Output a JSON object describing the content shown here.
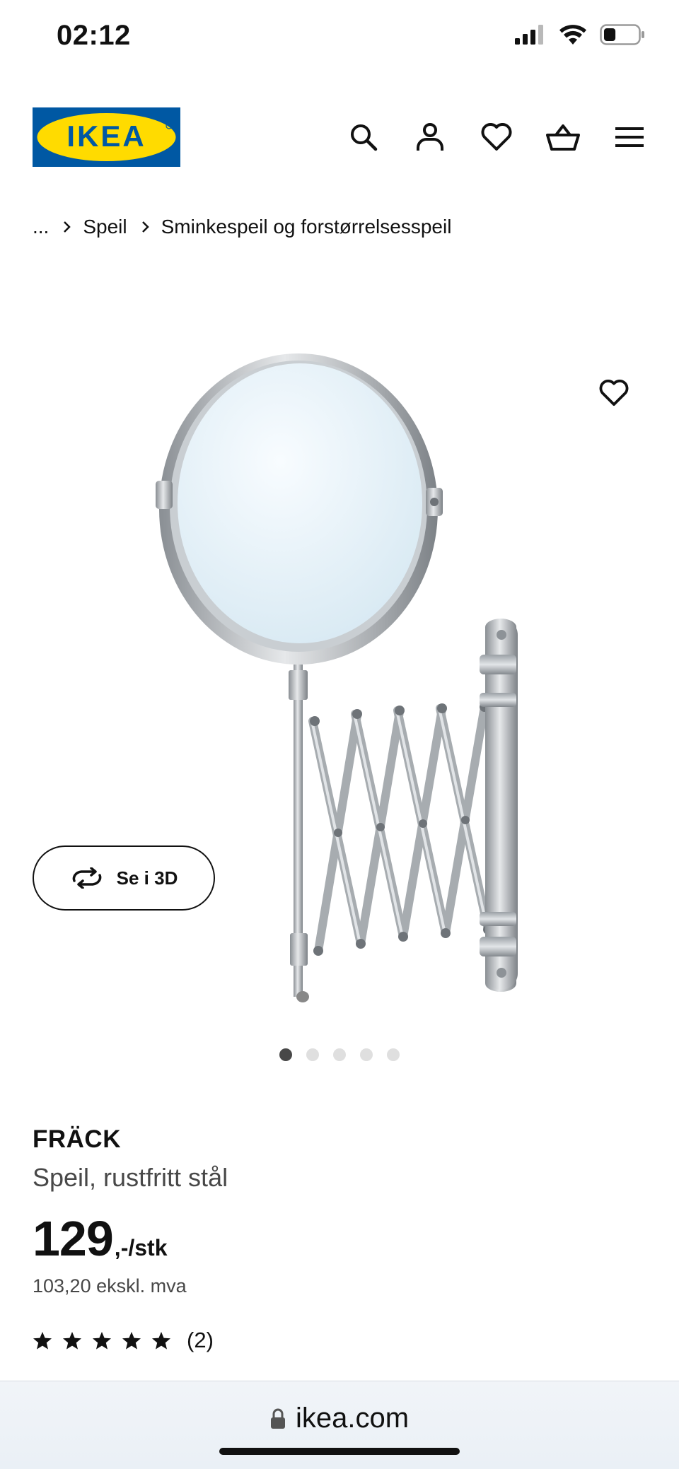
{
  "status_bar": {
    "time": "02:12",
    "battery_level": 0.35
  },
  "header": {
    "logo_text": "IKEA",
    "logo_colors": {
      "background": "#0058a3",
      "oval": "#ffdb00",
      "text": "#0058a3"
    },
    "icons": [
      "search-icon",
      "account-icon",
      "heart-icon",
      "basket-icon",
      "menu-icon"
    ]
  },
  "breadcrumb": {
    "items": [
      "...",
      "Speil",
      "Sminkespeil og forstørrelsesspeil"
    ]
  },
  "gallery": {
    "view_3d_label": "Se i 3D",
    "dot_count": 5,
    "active_dot": 0
  },
  "product": {
    "name": "FRÄCK",
    "description": "Speil, rustfritt stål",
    "price": "129",
    "price_suffix": ",-/stk",
    "price_ex_vat": "103,20 ekskl. mva",
    "rating_stars": 5,
    "review_count": "(2)"
  },
  "browser": {
    "url": "ikea.com"
  }
}
